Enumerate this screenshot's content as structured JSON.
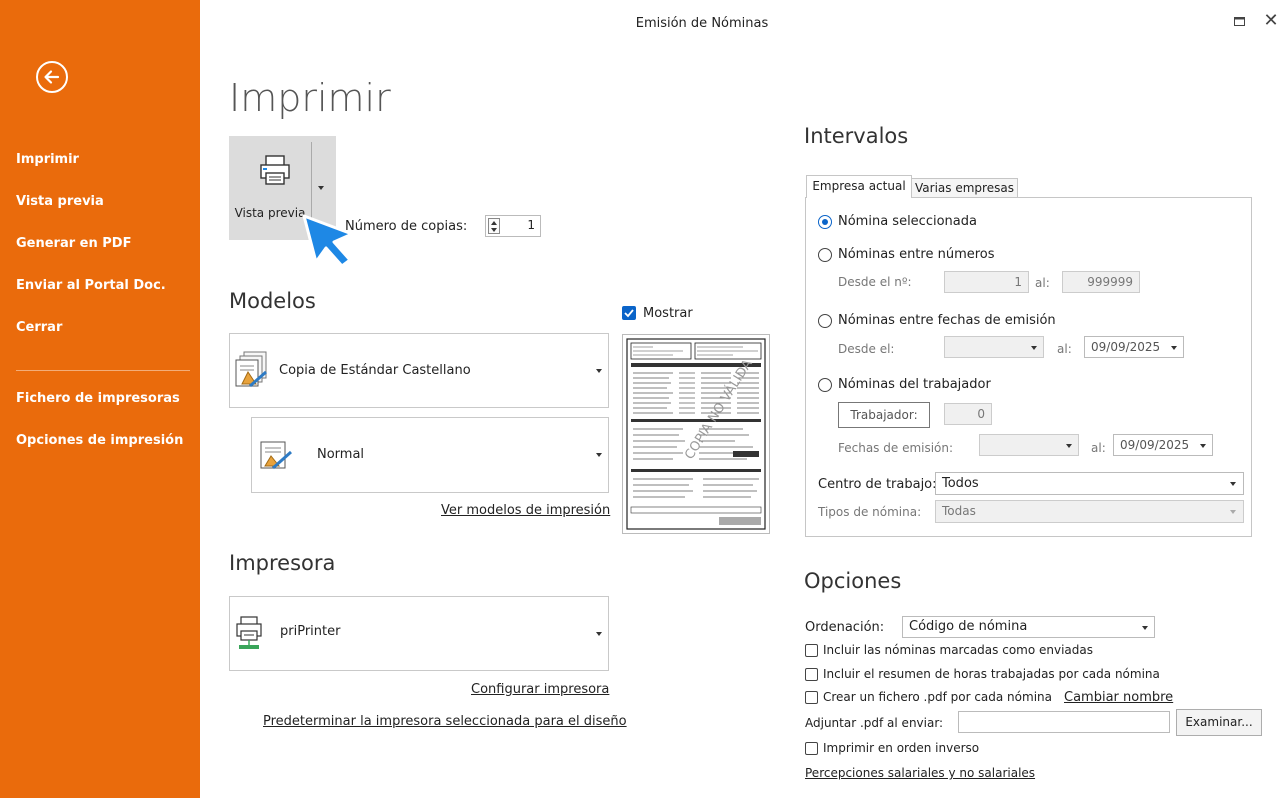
{
  "window": {
    "title": "Emisión de Nóminas"
  },
  "sidebar": {
    "items": [
      {
        "label": "Imprimir"
      },
      {
        "label": "Vista previa"
      },
      {
        "label": "Generar en PDF"
      },
      {
        "label": "Enviar al Portal Doc."
      },
      {
        "label": "Cerrar"
      },
      {
        "label": "Fichero de impresoras"
      },
      {
        "label": "Opciones de impresión"
      }
    ]
  },
  "main": {
    "title": "Imprimir",
    "preview_button": "Vista previa",
    "copies_label": "Número de copias:",
    "copies_value": "1",
    "models_title": "Modelos",
    "model_selected": "Copia de Estándar Castellano",
    "format_selected": "Normal",
    "models_link": "Ver modelos de impresión",
    "show_label": "Mostrar",
    "show_checked": true,
    "preview_watermark": "COPIA NO VÁLIDA",
    "printer_title": "Impresora",
    "printer_selected": "priPrinter",
    "configure_link": "Configurar impresora",
    "default_link": "Predeterminar la impresora seleccionada para el diseño"
  },
  "intervals": {
    "title": "Intervalos",
    "tabs": [
      {
        "label": "Empresa actual"
      },
      {
        "label": "Varias empresas"
      }
    ],
    "active_tab": 0,
    "radio_selected": "Nómina seleccionada",
    "radio_numbers": "Nóminas entre números",
    "from_no_label": "Desde el nº:",
    "from_no_value": "1",
    "to_label": "al:",
    "to_no_value": "999999",
    "radio_dates": "Nóminas entre fechas de emisión",
    "from_date_label": "Desde el:",
    "from_date_value": "",
    "to_date_value": "09/09/2025",
    "radio_worker": "Nóminas del trabajador",
    "worker_button": "Trabajador:",
    "worker_value": "0",
    "emission_dates_label": "Fechas de emisión:",
    "emission_from_value": "",
    "emission_to_value": "09/09/2025",
    "work_center_label": "Centro de trabajo:",
    "work_center_value": "Todos",
    "payroll_types_label": "Tipos de nómina:",
    "payroll_types_value": "Todas"
  },
  "options": {
    "title": "Opciones",
    "order_label": "Ordenación:",
    "order_value": "Código de nómina",
    "check1": "Incluir las nóminas marcadas como enviadas",
    "check2": "Incluir el resumen de horas trabajadas por cada nómina",
    "check3": "Crear un fichero .pdf por cada nómina",
    "rename_link": "Cambiar nombre",
    "attach_label": "Adjuntar .pdf al enviar:",
    "attach_value": "",
    "browse_button": "Examinar...",
    "check4": "Imprimir en orden inverso",
    "perceptions_link": "Percepciones salariales y no salariales"
  },
  "colors": {
    "accent": "#EA6B0C",
    "radio": "#0A64C9",
    "cursor": "#1E88E5"
  }
}
